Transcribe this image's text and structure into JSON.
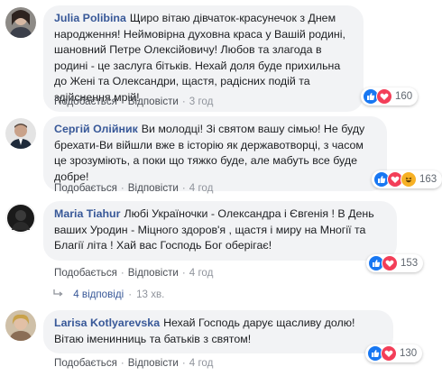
{
  "comments": [
    {
      "author": "Julia Polibina",
      "text": "Щиро вітаю дівчаток-красунечок з Днем народження! Неймовірна духовна краса у Вашій родині, шановний Петре Олексійовичу! Любов та злагода в родині - це заслуга бітьків. Нехай доля буде прихильна до Жені та Олександри, щастя, радісних подій та здійснення мрій!",
      "like": "Подобається",
      "reply": "Відповісти",
      "time": "3 год",
      "reactions": [
        "like-icon",
        "love-icon"
      ],
      "reaction_count": "160"
    },
    {
      "author": "Сергій Олійник",
      "text": "Ви молодці! Зі святом вашу сімью! Не буду брехати-Ви війшли вже в історію як державотворці, з часом це зрозуміють, а поки що тяжко буде, але мабуть все буде добре!",
      "like": "Подобається",
      "reply": "Відповісти",
      "time": "4 год",
      "reactions": [
        "like-icon",
        "love-icon",
        "haha-icon"
      ],
      "reaction_count": "163"
    },
    {
      "author": "Maria Tiahur",
      "text": "Любі Україночки - Олександра і Євгенія ! В День ваших Уродин - Міцного здоров'я , щастя і миру на Многії та Благії літа ! Хай вас Господь Бог оберігає!",
      "like": "Подобається",
      "reply": "Відповісти",
      "time": "4 год",
      "reactions": [
        "like-icon",
        "love-icon"
      ],
      "reaction_count": "153"
    },
    {
      "author": "Larisa Kotlyarevska",
      "text": "Нехай Господь дарує щасливу долю! Вітаю іменинниць та батьків з святом!",
      "like": "Подобається",
      "reply": "Відповісти",
      "time": "4 год",
      "reactions": [
        "like-icon",
        "love-icon"
      ],
      "reaction_count": "130"
    }
  ],
  "replies_toggle": {
    "label": "4 відповіді",
    "time": "13 хв."
  },
  "colors": {
    "author": "#385898",
    "bubble": "#f2f3f5",
    "like": "#1877f2",
    "love": "#f33e58",
    "haha": "#f7b125"
  }
}
